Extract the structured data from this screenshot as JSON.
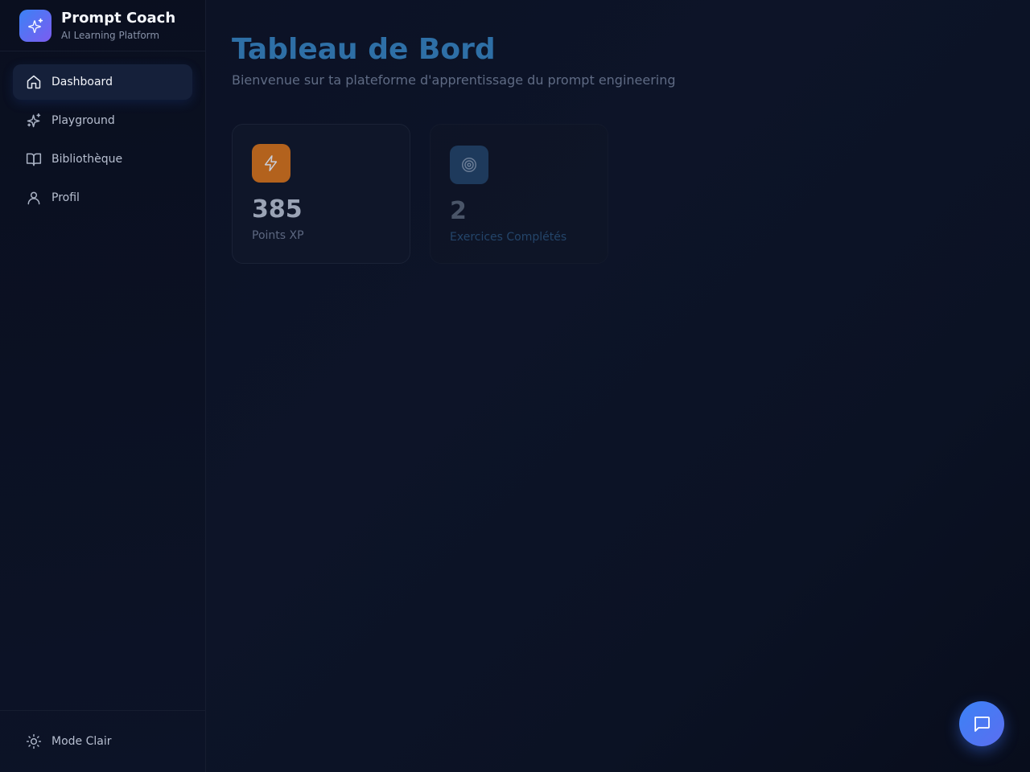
{
  "brand": {
    "title": "Prompt Coach",
    "subtitle": "AI Learning Platform",
    "logo_icon": "sparkles-icon"
  },
  "sidebar": {
    "items": [
      {
        "label": "Dashboard",
        "icon": "home-icon",
        "active": true
      },
      {
        "label": "Playground",
        "icon": "sparkles-icon",
        "active": false
      },
      {
        "label": "Bibliothèque",
        "icon": "book-open-icon",
        "active": false
      },
      {
        "label": "Profil",
        "icon": "user-icon",
        "active": false
      }
    ],
    "footer": {
      "label": "Mode Clair",
      "icon": "sun-icon"
    }
  },
  "main": {
    "title": "Tableau de Bord",
    "subtitle": "Bienvenue sur ta plateforme d'apprentissage du prompt engineering",
    "stats": [
      {
        "value": "385",
        "label": "Points XP",
        "icon": "zap-icon",
        "accent": "#b3621d"
      },
      {
        "value": "2",
        "label": "Exercices Complétés",
        "icon": "target-icon",
        "accent": "#1e3a5c"
      }
    ]
  },
  "chat_button": {
    "icon": "message-square-icon",
    "accent": "#3b82f6"
  }
}
